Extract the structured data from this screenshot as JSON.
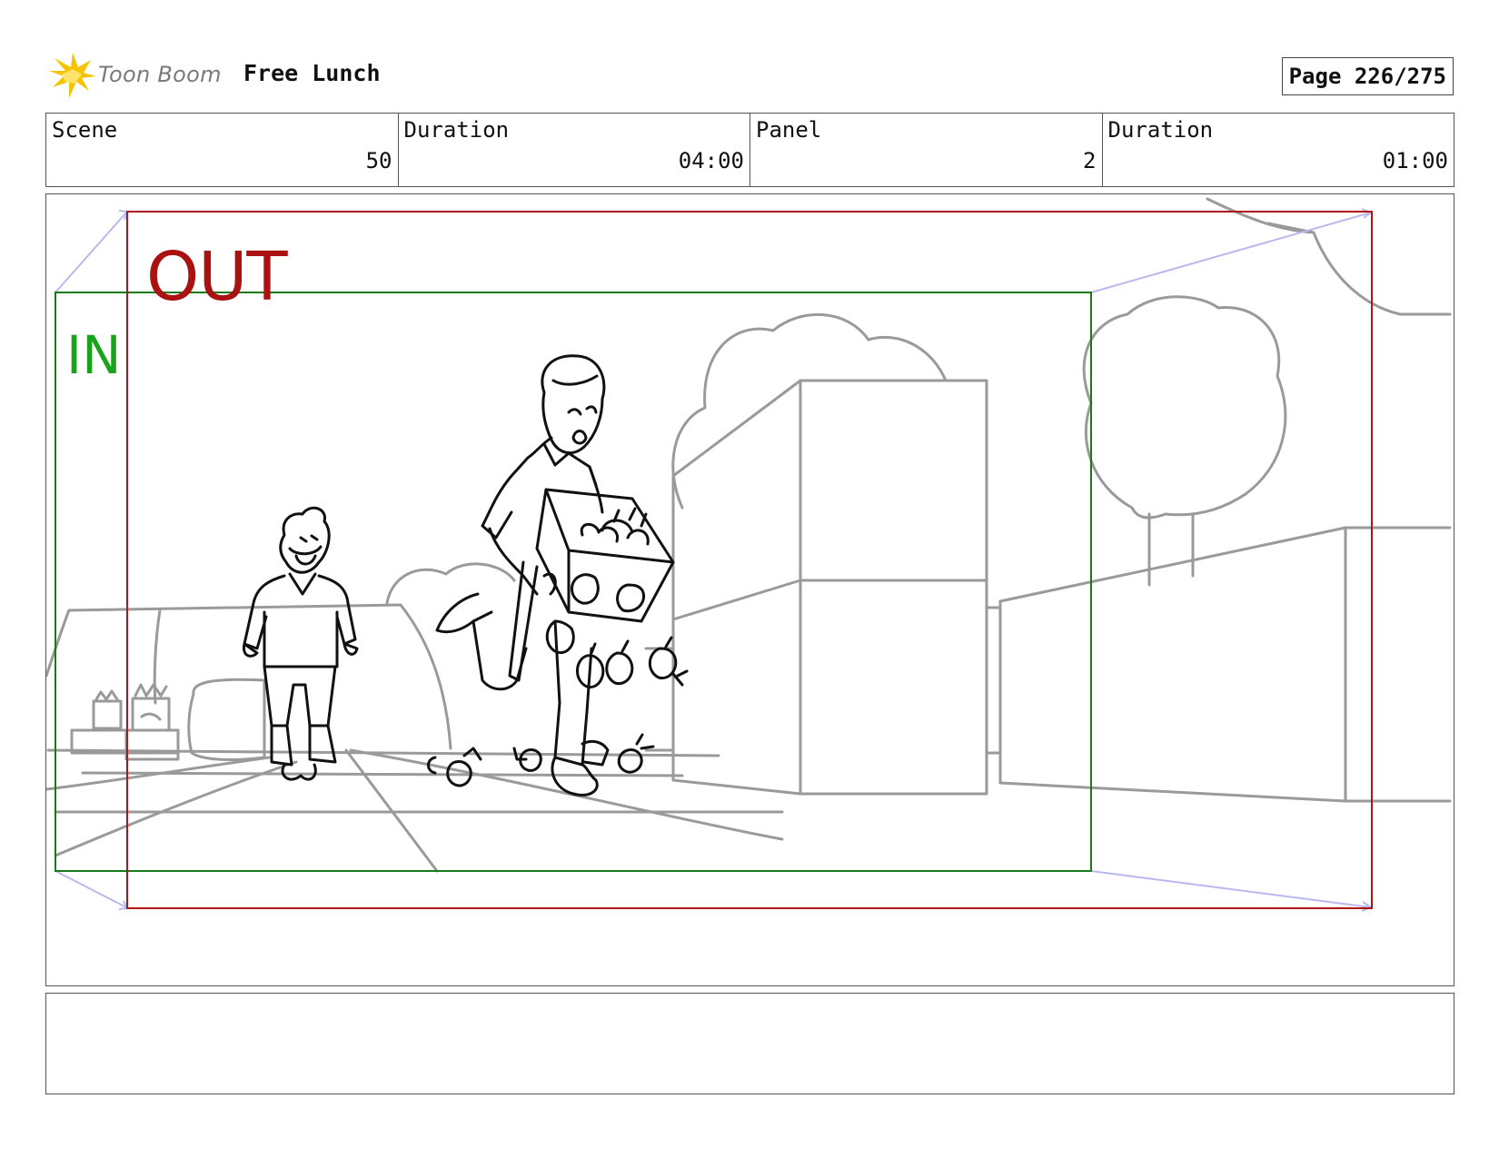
{
  "header": {
    "brand": "Toon Boom",
    "project_title": "Free Lunch",
    "page_label": "Page 226/275"
  },
  "info": {
    "scene_label": "Scene",
    "scene_value": "50",
    "scene_duration_label": "Duration",
    "scene_duration_value": "04:00",
    "panel_label": "Panel",
    "panel_value": "2",
    "panel_duration_label": "Duration",
    "panel_duration_value": "01:00"
  },
  "panel": {
    "out_label": "OUT",
    "in_label": "IN",
    "out_frame_color": "#b01515",
    "in_frame_color": "#1a7a1a",
    "camera_path_color": "#b9b9ee"
  },
  "notes": {
    "text": ""
  }
}
